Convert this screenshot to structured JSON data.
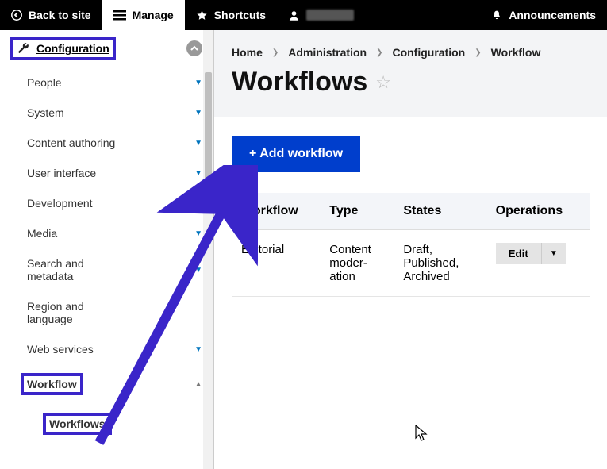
{
  "toolbar": {
    "back_label": "Back to site",
    "manage_label": "Manage",
    "shortcuts_label": "Shortcuts",
    "announcements_label": "Announcements"
  },
  "sidebar": {
    "header_label": "Configuration",
    "items": [
      {
        "label": "People"
      },
      {
        "label": "System"
      },
      {
        "label": "Content authoring"
      },
      {
        "label": "User interface"
      },
      {
        "label": "Development"
      },
      {
        "label": "Media"
      },
      {
        "label": "Search and metadata"
      },
      {
        "label": "Region and language"
      },
      {
        "label": "Web services"
      }
    ],
    "section_label": "Workflow",
    "sub_label": "Workflows"
  },
  "breadcrumbs": {
    "items": [
      "Home",
      "Administration",
      "Configuration",
      "Workflow"
    ]
  },
  "page": {
    "title": "Workflows",
    "add_button": "+ Add workflow"
  },
  "table": {
    "headers": [
      "Workflow",
      "Type",
      "States",
      "Operations"
    ],
    "rows": [
      {
        "workflow": "Editorial",
        "type": "Content moderation",
        "states": "Draft, Published, Archived",
        "op": "Edit"
      }
    ]
  }
}
